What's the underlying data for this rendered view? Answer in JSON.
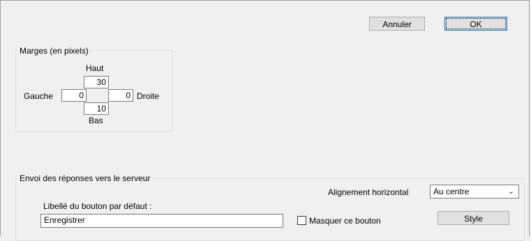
{
  "buttons": {
    "cancel": "Annuler",
    "ok": "OK",
    "style": "Style"
  },
  "margins": {
    "title": "Marges (en pixels)",
    "top_label": "Haut",
    "top_value": "30",
    "left_label": "Gauche",
    "left_value": "0",
    "right_value": "0",
    "right_label": "Droite",
    "bottom_value": "10",
    "bottom_label": "Bas"
  },
  "submit": {
    "title": "Envoi des réponses vers le serveur",
    "align_label": "Alignement horizontal",
    "align_value": "Au centre",
    "button_label_caption": "Libellé du bouton par défaut :",
    "button_label_value": "Enregistrer",
    "hide_label": "Masquer ce bouton",
    "hide_checked": false
  },
  "icons": {
    "dropdown": "chevron-down-icon"
  }
}
